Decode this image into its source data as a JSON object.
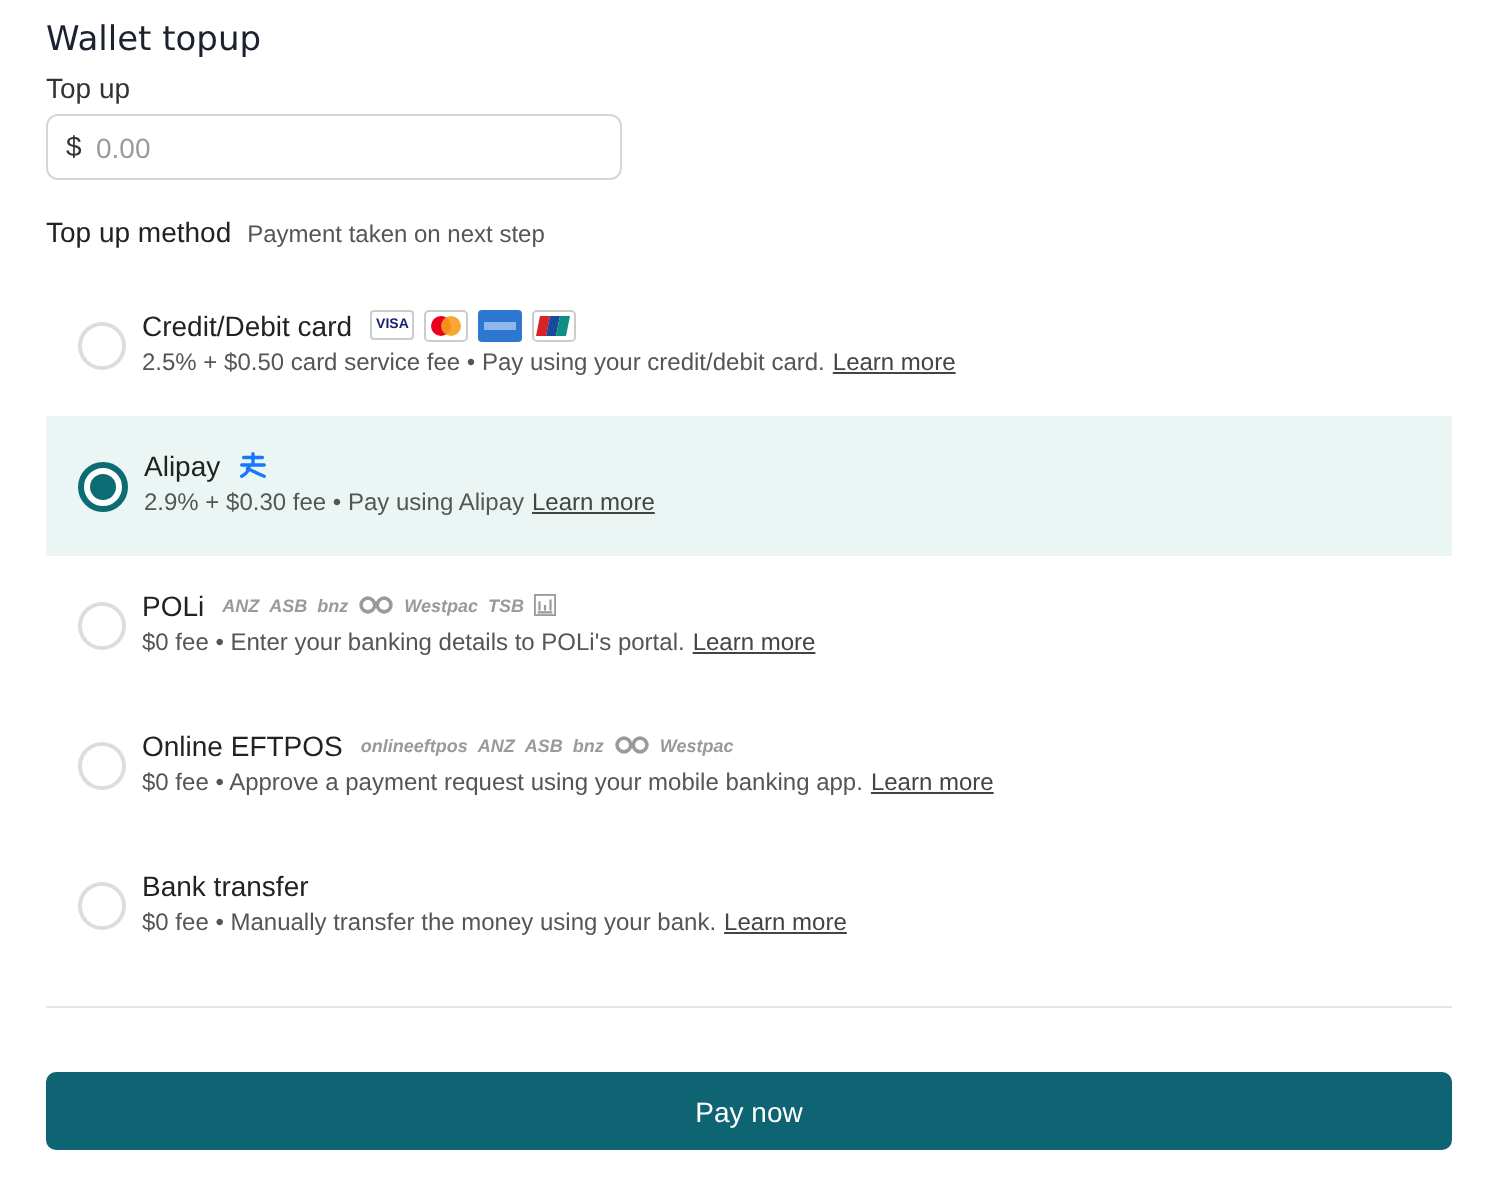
{
  "title": "Wallet topup",
  "amount": {
    "label": "Top up",
    "currency": "$",
    "placeholder": "0.00"
  },
  "method": {
    "label": "Top up method",
    "hint": "Payment taken on next step"
  },
  "options": [
    {
      "name": "Credit/Debit card",
      "selected": false,
      "description": "2.5% + $0.50 card service fee • Pay using your credit/debit card.",
      "link": "Learn more",
      "logos": [
        {
          "kind": "card",
          "text": "VISA"
        },
        {
          "kind": "mastercard"
        },
        {
          "kind": "amex"
        },
        {
          "kind": "unionpay"
        }
      ]
    },
    {
      "name": "Alipay",
      "selected": true,
      "description": "2.9% + $0.30 fee • Pay using Alipay",
      "link": "Learn more",
      "logos": [
        {
          "kind": "alipay"
        }
      ]
    },
    {
      "name": "POLi",
      "selected": false,
      "description": "$0 fee • Enter your banking details to POLi's portal.",
      "link": "Learn more",
      "logos": [
        {
          "kind": "word",
          "text": "ANZ"
        },
        {
          "kind": "word",
          "text": "ASB"
        },
        {
          "kind": "word",
          "text": "bnz"
        },
        {
          "kind": "infinity"
        },
        {
          "kind": "word",
          "text": "Westpac"
        },
        {
          "kind": "word",
          "text": "TSB"
        },
        {
          "kind": "bank"
        }
      ]
    },
    {
      "name": "Online EFTPOS",
      "selected": false,
      "description": "$0 fee • Approve a payment request using your mobile banking app.",
      "link": "Learn more",
      "logos": [
        {
          "kind": "word",
          "text": "onlineeftpos"
        },
        {
          "kind": "word",
          "text": "ANZ"
        },
        {
          "kind": "word",
          "text": "ASB"
        },
        {
          "kind": "word",
          "text": "bnz"
        },
        {
          "kind": "infinity"
        },
        {
          "kind": "word",
          "text": "Westpac"
        }
      ]
    },
    {
      "name": "Bank transfer",
      "selected": false,
      "description": "$0 fee • Manually transfer the money using your bank.",
      "link": "Learn more"
    }
  ],
  "submit": "Pay now"
}
